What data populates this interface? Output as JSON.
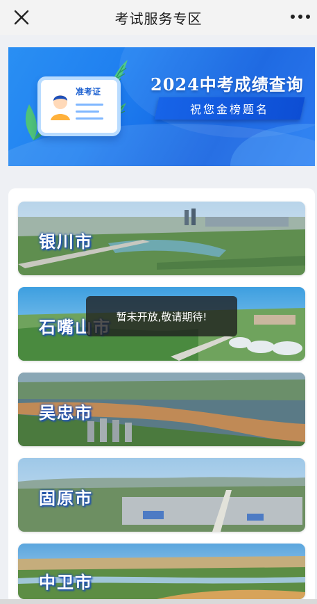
{
  "navbar": {
    "title": "考试服务专区",
    "close_icon": "close-icon",
    "more_icon": "more-icon"
  },
  "banner": {
    "title": "2024中考成绩查询",
    "subtitle": "祝您金榜题名",
    "ticket_label": "准考证",
    "colors": {
      "background": "#1f7ff0",
      "ribbon": "#0d4ed4"
    }
  },
  "cities": [
    {
      "name": "银川市"
    },
    {
      "name": "石嘴山市"
    },
    {
      "name": "吴忠市"
    },
    {
      "name": "固原市"
    },
    {
      "name": "中卫市"
    }
  ],
  "toast": {
    "message": "暂未开放,敬请期待!"
  }
}
